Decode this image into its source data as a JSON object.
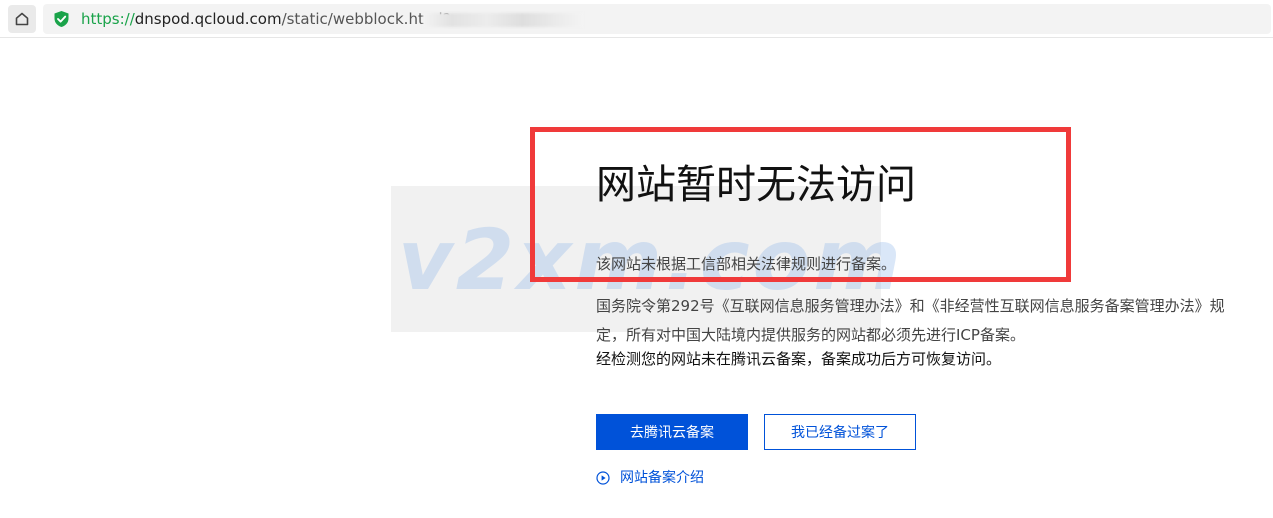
{
  "browser": {
    "url_scheme": "https://",
    "url_host": "dnspod.qcloud.com",
    "url_path": "/static/webblock.html?c",
    "home_icon": "home-icon",
    "secure_icon": "shield-check-icon",
    "secure_color": "#1aa34a"
  },
  "watermark": {
    "text": "v2xm.com"
  },
  "page": {
    "title": "网站暂时无法访问",
    "line1": "该网站未根据工信部相关法律规则进行备案。",
    "line2": "国务院令第292号《互联网信息服务管理办法》和《非经营性互联网信息服务备案管理办法》规定，所有对中国大陆境内提供服务的网站都必须先进行ICP备案。",
    "line3": "经检测您的网站未在腾讯云备案，备案成功后方可恢复访问。",
    "primary_button": "去腾讯云备案",
    "secondary_button": "我已经备过案了",
    "intro_link": "网站备案介绍",
    "intro_icon": "play-circle-icon",
    "accent_color": "#0052d9",
    "highlight_color": "#f03a3a"
  }
}
